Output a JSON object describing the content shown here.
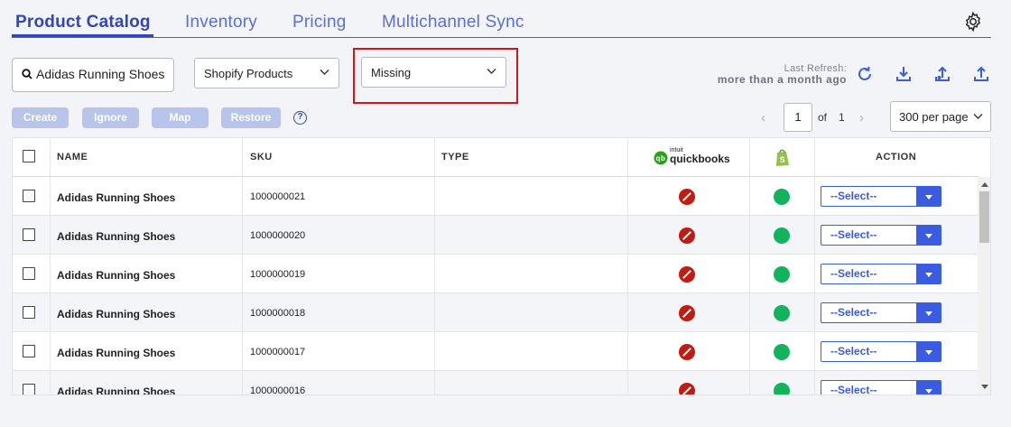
{
  "tabs": [
    {
      "label": "Product Catalog",
      "active": true
    },
    {
      "label": "Inventory"
    },
    {
      "label": "Pricing"
    },
    {
      "label": "Multichannel Sync"
    }
  ],
  "search": {
    "value": "Adidas Running Shoes"
  },
  "filters": {
    "source": "Shopify Products",
    "status": "Missing"
  },
  "refresh": {
    "label": "Last Refresh:",
    "value": "more than a month ago"
  },
  "actions": {
    "create": "Create",
    "ignore": "Ignore",
    "map": "Map",
    "restore": "Restore",
    "help": "?"
  },
  "pagination": {
    "current": "1",
    "of": "of",
    "total": "1",
    "per_page": "300 per page"
  },
  "table": {
    "headers": {
      "name": "NAME",
      "sku": "SKU",
      "type": "TYPE",
      "quickbooks_intuit": "intuit",
      "quickbooks": "quickbooks",
      "action": "ACTION"
    },
    "rows": [
      {
        "name": "Adidas Running Shoes",
        "sku": "1000000021",
        "type": "",
        "action": "--Select--"
      },
      {
        "name": "Adidas Running Shoes",
        "sku": "1000000020",
        "type": "",
        "action": "--Select--"
      },
      {
        "name": "Adidas Running Shoes",
        "sku": "1000000019",
        "type": "",
        "action": "--Select--"
      },
      {
        "name": "Adidas Running Shoes",
        "sku": "1000000018",
        "type": "",
        "action": "--Select--"
      },
      {
        "name": "Adidas Running Shoes",
        "sku": "1000000017",
        "type": "",
        "action": "--Select--"
      },
      {
        "name": "Adidas Running Shoes",
        "sku": "1000000016",
        "type": "",
        "action": "--Select--"
      }
    ]
  },
  "colors": {
    "accent": "#3346b8",
    "highlight": "#d6141a",
    "missing": "#c01c12",
    "synced": "#12b35d",
    "select_blue": "#3a5ce0"
  },
  "icons": {
    "gear": "gear-icon",
    "search": "search-icon",
    "refresh": "refresh-icon",
    "download": "download-icon",
    "upload_alt": "upload-dot-icon",
    "upload": "upload-icon",
    "quickbooks": "quickbooks-logo",
    "shopify": "shopify-logo"
  }
}
